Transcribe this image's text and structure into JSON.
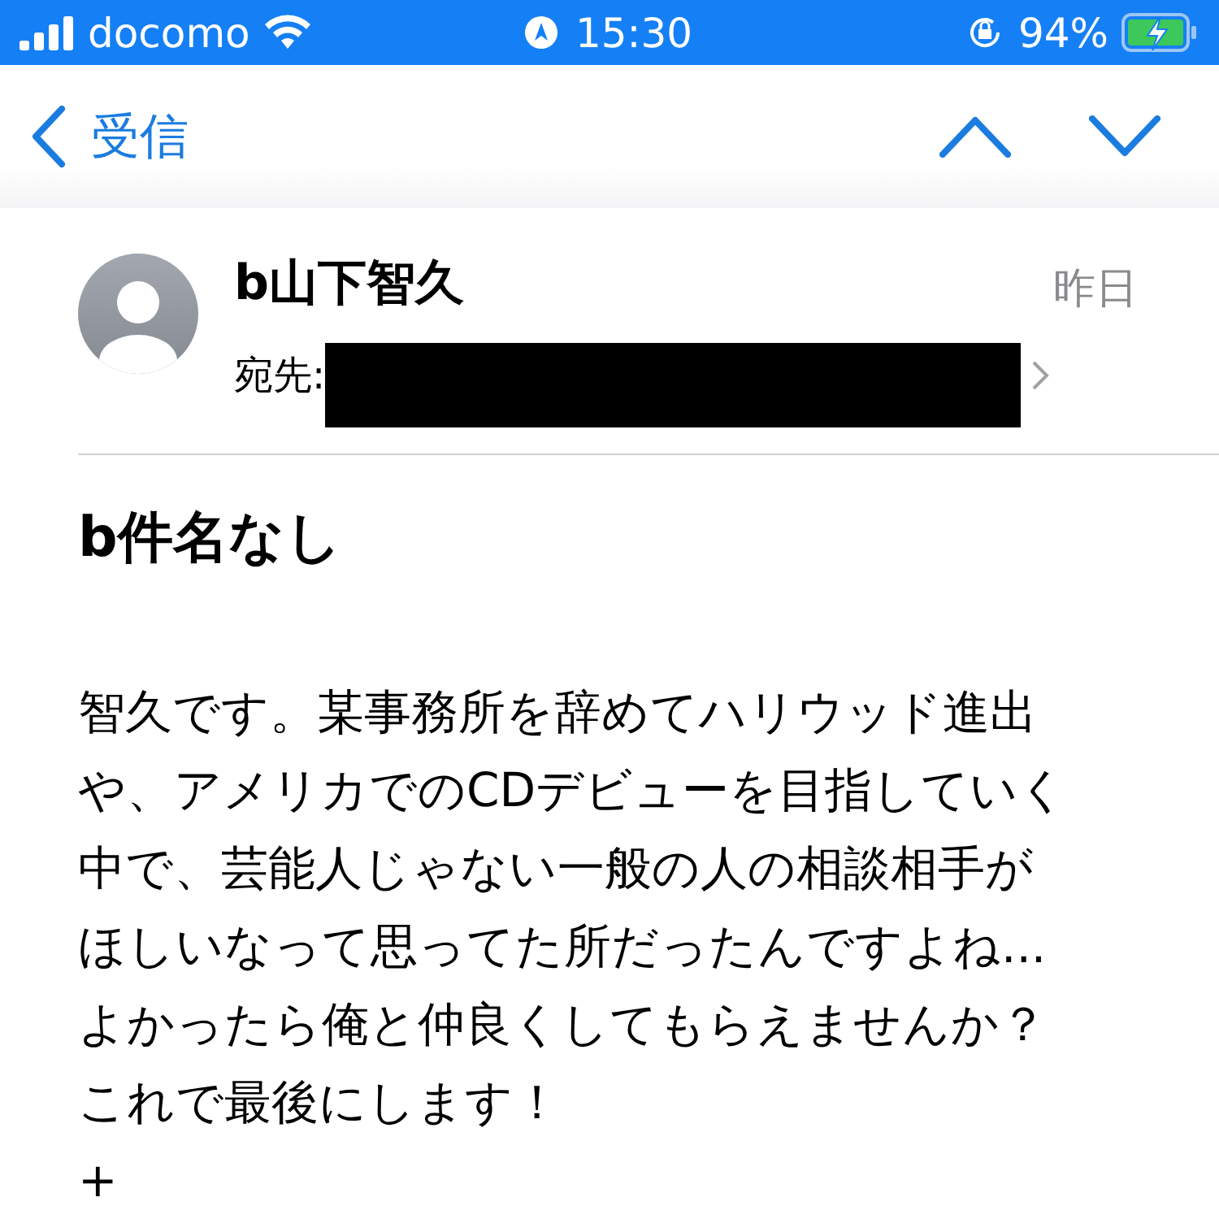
{
  "status_bar": {
    "carrier": "docomo",
    "time": "15:30",
    "battery_percent": "94%",
    "charging": true
  },
  "nav": {
    "back_label": "受信"
  },
  "message": {
    "sender": "b山下智久",
    "to_label": "宛先:",
    "date": "昨日",
    "subject": "b件名なし",
    "body_lines": [
      "智久です。某事務所を辞めてハリウッド進出",
      "や、アメリカでのCDデビューを目指していく",
      "中で、芸能人じゃない一般の人の相談相手が",
      "ほしいなって思ってた所だったんですよね...",
      "よかったら俺と仲良くしてもらえませんか？",
      "これで最後にします！",
      "+"
    ]
  }
}
